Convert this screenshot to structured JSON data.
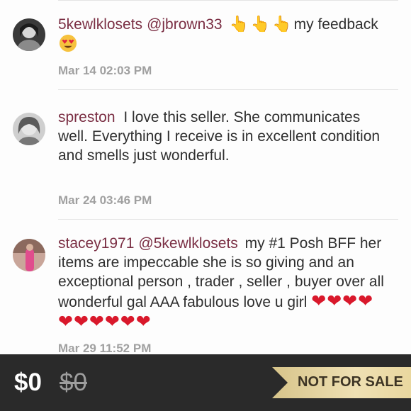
{
  "comments": [
    {
      "username": "5kewlklosets",
      "mention": "@jbrown33",
      "hand_emojis": "👆👆👆",
      "text_after": "my feedback",
      "time": "Mar 14 02:03 PM"
    },
    {
      "username": "spreston",
      "text": "I love this seller. She communicates well. Everything I receive is in excellent condition and smells just wonderful.",
      "time": "Mar 24 03:46 PM"
    },
    {
      "username": "stacey1971",
      "mention": "@5kewlklosets",
      "text": "my #1 Posh BFF her items are impeccable she is so giving and an exceptional person , trader , seller , buyer over all wonderful gal AAA fabulous love u girl",
      "hearts": "❤❤❤❤❤❤❤❤❤❤",
      "time": "Mar 29 11:52 PM"
    }
  ],
  "footer": {
    "price": "$0",
    "original_price": "$0",
    "status": "NOT FOR SALE"
  },
  "colors": {
    "username": "#7a2e43",
    "footer_bg": "#2a2a2a",
    "ribbon": "#e9d79f"
  }
}
